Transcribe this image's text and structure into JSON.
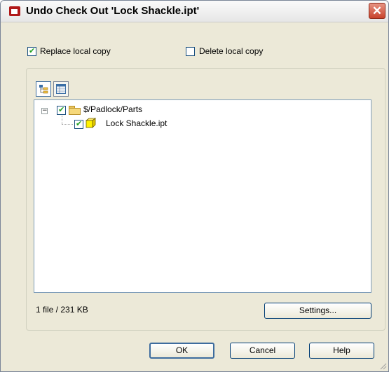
{
  "window": {
    "title": "Undo Check Out 'Lock Shackle.ipt'",
    "close_glyph": "✕"
  },
  "options": {
    "replace_label": "Replace  local copy",
    "replace_checked": true,
    "delete_label": "Delete  local copy",
    "delete_checked": false
  },
  "toolbar": {
    "tree_view_icon": "tree-view-icon",
    "list_view_icon": "list-view-icon"
  },
  "tree": {
    "root": {
      "label": "$/Padlock/Parts",
      "expanded": true,
      "checked": true,
      "icon": "folder-icon",
      "expander_glyph": "−"
    },
    "children": [
      {
        "label": "Lock Shackle.ipt",
        "checked": true,
        "icon": "part-file-icon"
      }
    ]
  },
  "status": {
    "text": "1 file / 231 KB"
  },
  "buttons": {
    "settings": "Settings...",
    "ok": "OK",
    "cancel": "Cancel",
    "help": "Help"
  }
}
